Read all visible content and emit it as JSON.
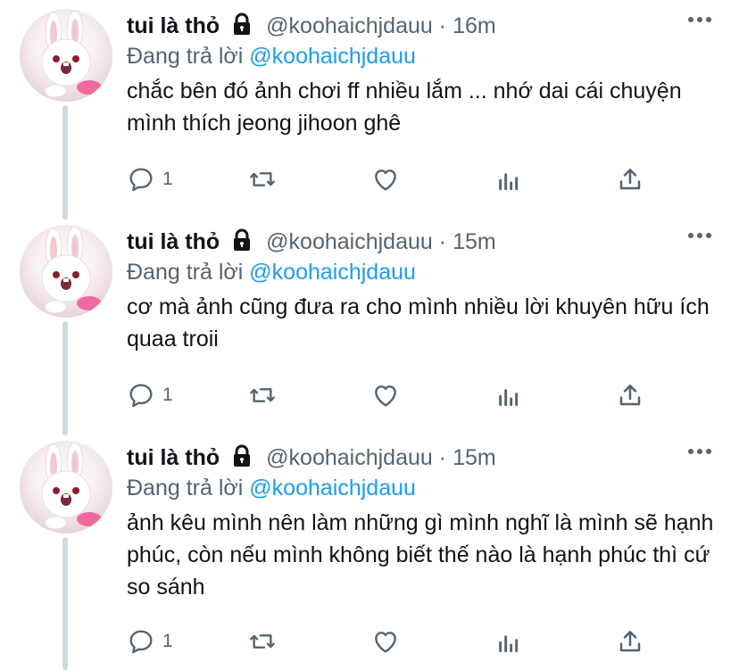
{
  "tweets": [
    {
      "name": "tui là thỏ",
      "handle": "@koohaichjdauu",
      "separator": "·",
      "time": "16m",
      "replying_prefix": "Đang trả lời",
      "replying_to": "@koohaichjdauu",
      "text": "chắc bên đó ảnh chơi ff nhiều lắm ... nhớ dai cái chuyện mình thích jeong jihoon ghê",
      "reply_count": "1"
    },
    {
      "name": "tui là thỏ",
      "handle": "@koohaichjdauu",
      "separator": "·",
      "time": "15m",
      "replying_prefix": "Đang trả lời",
      "replying_to": "@koohaichjdauu",
      "text": "cơ mà ảnh cũng đưa ra cho mình nhiều lời khuyên hữu ích quaa troii",
      "reply_count": "1"
    },
    {
      "name": "tui là thỏ",
      "handle": "@koohaichjdauu",
      "separator": "·",
      "time": "15m",
      "replying_prefix": "Đang trả lời",
      "replying_to": "@koohaichjdauu",
      "text": "ảnh kêu mình nên làm những gì mình nghĩ là mình sẽ hạnh phúc, còn nếu mình không biết thế nào là hạnh phúc thì cứ so sánh",
      "reply_count": "1"
    }
  ],
  "icons": {
    "lock": "lock-icon",
    "more": "more-icon",
    "reply": "reply-icon",
    "retweet": "retweet-icon",
    "like": "like-icon",
    "analytics": "analytics-icon",
    "share": "share-icon"
  },
  "colors": {
    "text": "#0f1419",
    "secondary": "#536471",
    "link": "#1d9bf0",
    "thread_line": "#cfd9de"
  }
}
